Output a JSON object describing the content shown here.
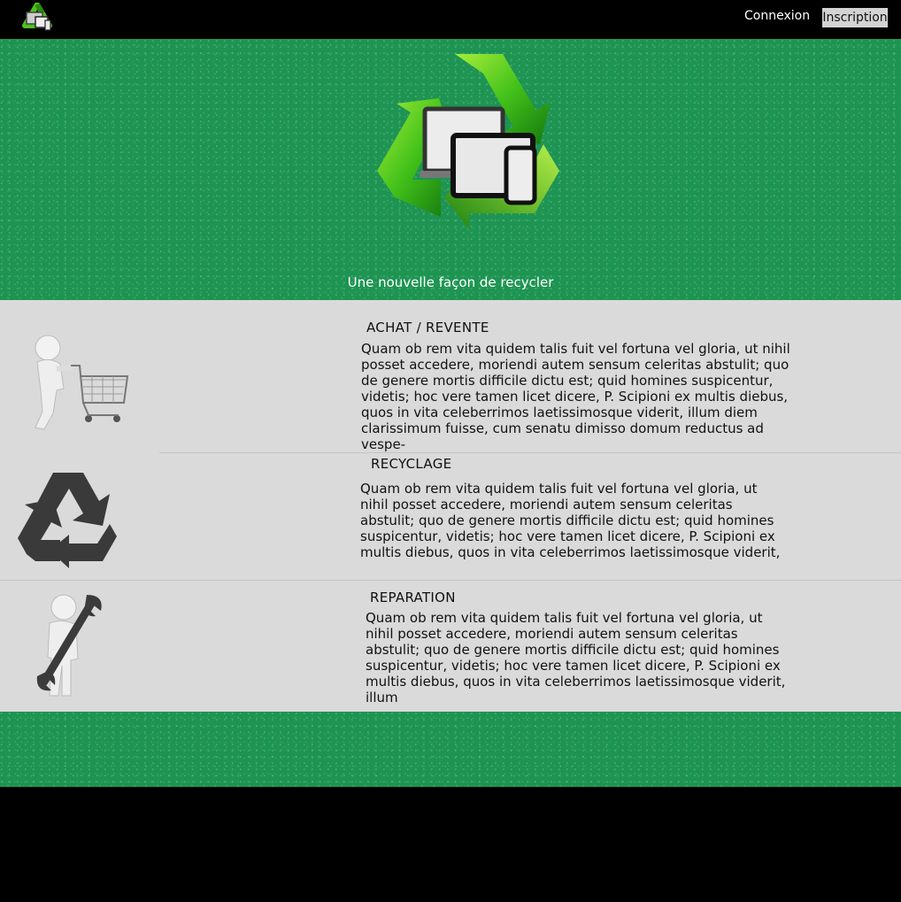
{
  "header": {
    "logo": "recycle-devices-logo",
    "nav": {
      "connexion_label": "Connexion",
      "inscription_label": "Inscription"
    }
  },
  "hero": {
    "logo": "recycle-devices-logo",
    "tagline": "Une nouvelle façon de recycler"
  },
  "sections": [
    {
      "icon": "person-shopping-cart-icon",
      "title": "ACHAT / REVENTE",
      "text": "Quam ob rem vita quidem talis fuit vel fortuna vel gloria, ut nihil posset accedere, moriendi autem sensum celeritas abstulit; quo de genere mortis difficile dictu est; quid homines suspicentur, videtis; hoc vere tamen licet dicere, P. Scipioni ex multis diebus, quos in vita celeberrimos laetissimosque viderit, illum diem clarissimum fuisse, cum senatu dimisso domum reductus ad vespe-"
    },
    {
      "icon": "recycle-icon",
      "title": "RECYCLAGE",
      "text": "Quam ob rem vita quidem talis fuit vel fortuna vel gloria, ut nihil posset accedere, moriendi autem sensum celeritas abstulit; quo de genere mortis difficile dictu est; quid homines suspicentur, videtis; hoc vere tamen licet dicere, P. Scipioni ex multis diebus, quos in vita celeberrimos laetissimosque viderit,"
    },
    {
      "icon": "person-wrench-icon",
      "title": "REPARATION",
      "text": "Quam ob rem vita quidem talis fuit vel fortuna vel gloria, ut nihil posset accedere, moriendi autem sensum celeritas abstulit; quo de genere mortis difficile dictu est; quid homines suspicentur, videtis; hoc vere tamen licet dicere, P. Scipioni ex multis diebus, quos in vita celeberrimos laetissimosque viderit, illum"
    }
  ],
  "colors": {
    "header_bg": "#000000",
    "hero_green": "#1d9452",
    "content_bg": "#dadada",
    "button_bg": "#d3d3d3",
    "logo_green": "#3fbf1f"
  }
}
